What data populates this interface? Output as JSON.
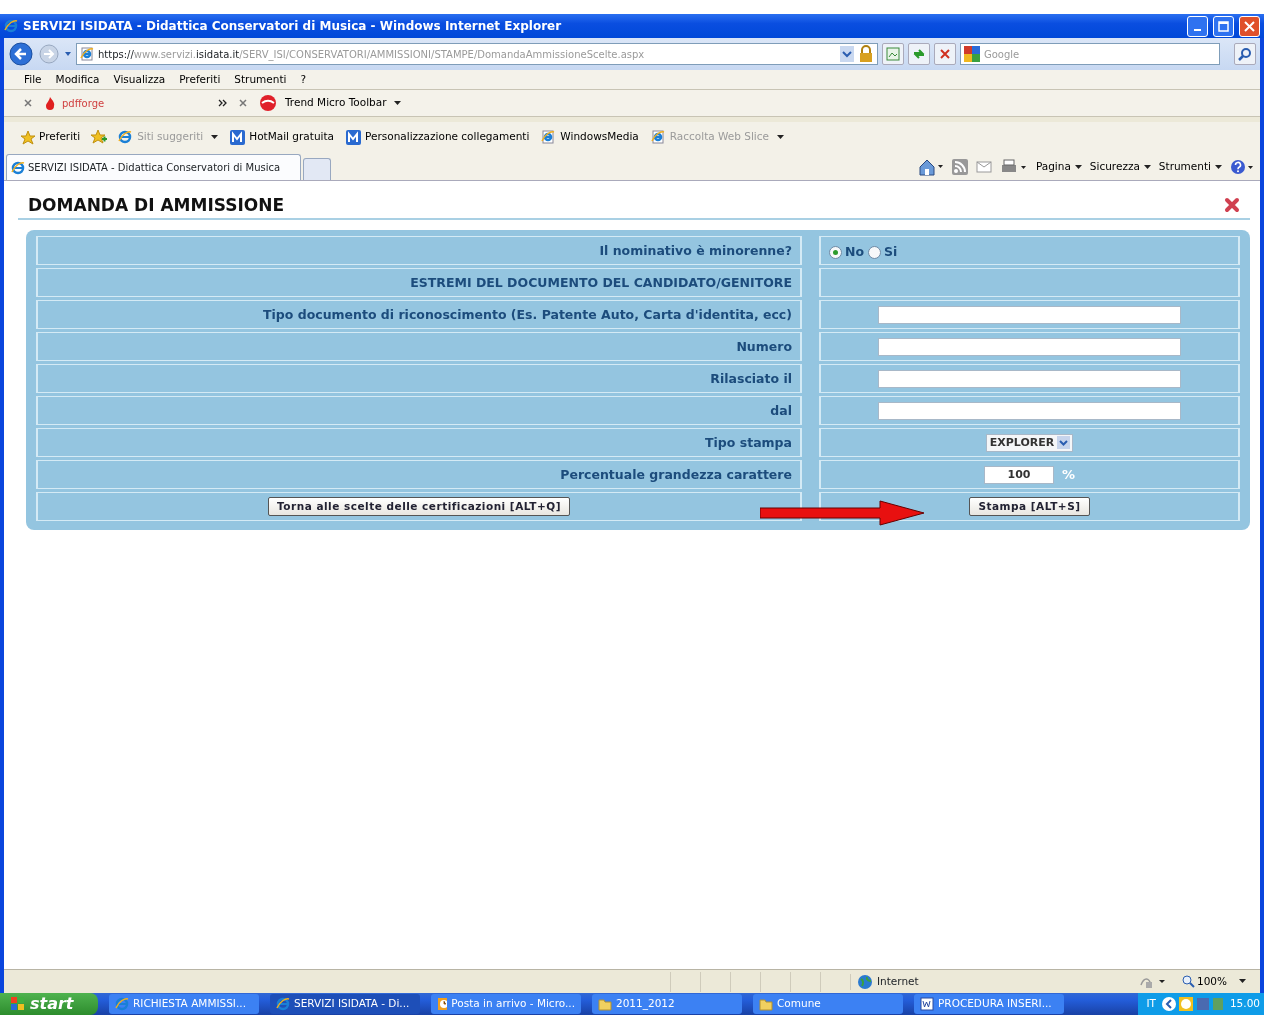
{
  "window": {
    "title": "SERVIZI ISIDATA - Didattica Conservatori di Musica - Windows Internet Explorer"
  },
  "address_bar": {
    "url_parts": [
      {
        "text": "https://",
        "dim": false
      },
      {
        "text": "www.servizi.",
        "dim": true
      },
      {
        "text": "isidata.it",
        "dim": false
      },
      {
        "text": "/SERV_ISI/CONSERVATORI/AMMISSIONI/STAMPE/DomandaAmmissioneScelte.aspx",
        "dim": true
      }
    ]
  },
  "search": {
    "placeholder": "Google"
  },
  "menu": [
    "File",
    "Modifica",
    "Visualizza",
    "Preferiti",
    "Strumenti",
    "?"
  ],
  "toolbars": [
    {
      "kind": "pdfforge",
      "label": "pdfforge"
    },
    {
      "kind": "trend",
      "label": "Trend Micro Toolbar"
    }
  ],
  "favorites": [
    {
      "label": "Preferiti",
      "kind": "star",
      "dim": false
    },
    {
      "label": "Siti suggeriti",
      "kind": "ie",
      "dim": true
    },
    {
      "label": "HotMail gratuita",
      "kind": "m",
      "dim": false
    },
    {
      "label": "Personalizzazione collegamenti",
      "kind": "m",
      "dim": false
    },
    {
      "label": "WindowsMedia",
      "kind": "page",
      "dim": false
    },
    {
      "label": "Raccolta Web Slice",
      "kind": "page",
      "dim": true
    }
  ],
  "tabs": [
    {
      "label": "SERVIZI ISIDATA - Didattica Conservatori di Musica",
      "selected": true
    }
  ],
  "command_bar": [
    "Pagina",
    "Sicurezza",
    "Strumenti"
  ],
  "page": {
    "heading": "DOMANDA DI AMMISSIONE",
    "rows": [
      {
        "kind": "radio",
        "label": "Il nominativo è minorenne?",
        "options": [
          {
            "label": "No",
            "selected": true
          },
          {
            "label": "Si",
            "selected": false
          }
        ]
      },
      {
        "kind": "empty",
        "label": "ESTREMI DEL DOCUMENTO DEL CANDIDATO/GENITORE"
      },
      {
        "kind": "input",
        "label": "Tipo documento di riconoscimento (Es. Patente Auto, Carta d'identita, ecc)"
      },
      {
        "kind": "input",
        "label": "Numero"
      },
      {
        "kind": "input",
        "label": "Rilasciato il"
      },
      {
        "kind": "input",
        "label": "dal"
      },
      {
        "kind": "select",
        "label": "Tipo stampa",
        "value": "EXPLORER"
      },
      {
        "kind": "percent",
        "label": "Percentuale grandezza carattere",
        "value": "100",
        "unit": "%"
      },
      {
        "kind": "buttons",
        "left_button": "Torna alle scelte delle certificazioni [ALT+Q]",
        "right_button": "Stampa [ALT+S]"
      }
    ]
  },
  "status_bar": {
    "zone": "Internet",
    "zoom": "100%"
  },
  "taskbar": {
    "start": "start",
    "items": [
      {
        "label": "RICHIESTA AMMISSI...",
        "kind": "ie",
        "selected": false
      },
      {
        "label": "SERVIZI ISIDATA - Di...",
        "kind": "ie",
        "selected": true
      },
      {
        "label": "Posta in arrivo - Micro...",
        "kind": "mail",
        "selected": false
      },
      {
        "label": "2011_2012",
        "kind": "folder",
        "selected": false
      },
      {
        "label": "Comune",
        "kind": "folder",
        "selected": false
      },
      {
        "label": "PROCEDURA INSERI...",
        "kind": "word",
        "selected": false
      }
    ],
    "language": "IT",
    "clock": "15.00"
  }
}
